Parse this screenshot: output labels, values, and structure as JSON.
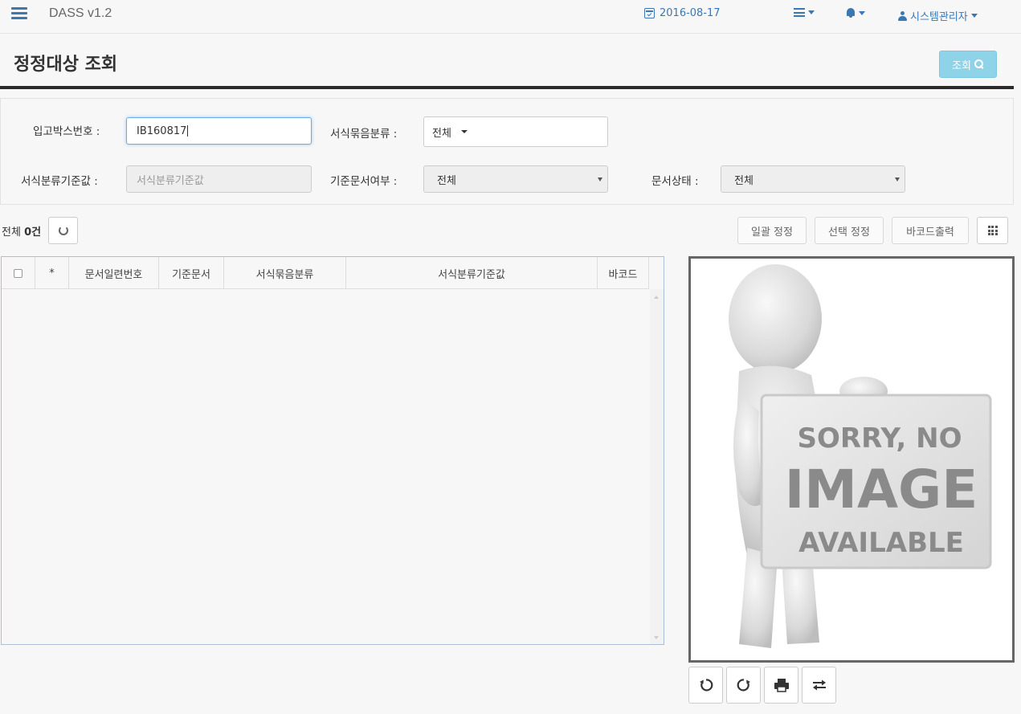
{
  "app": {
    "title": "DASS v1.2",
    "date": "2016-08-17",
    "user": "시스템관리자"
  },
  "page": {
    "title": "정정대상 조회",
    "search_label": "조회"
  },
  "form": {
    "box_no_label": "입고박스번호 :",
    "box_no_value": "IB160817",
    "group_label": "서식묶음분류 :",
    "group_value": "전체",
    "criteria_label": "서식분류기준값 :",
    "criteria_placeholder": "서식분류기준값",
    "std_doc_label": "기준문서여부 :",
    "std_doc_value": "전체",
    "doc_status_label": "문서상태 :",
    "doc_status_value": "전체"
  },
  "toolbar": {
    "count_prefix": "전체",
    "count_value": "0건",
    "bulk_correct": "일괄 정정",
    "select_correct": "선택 정정",
    "barcode_print": "바코드출력"
  },
  "table": {
    "columns": [
      "*",
      "문서일련번호",
      "기준문서",
      "서식묶음분류",
      "서식분류기준값",
      "바코드"
    ],
    "rows": []
  },
  "viewer": {
    "placeholder_line1": "SORRY, NO",
    "placeholder_line2": "IMAGE",
    "placeholder_line3": "AVAILABLE"
  },
  "icons": {
    "menu": "menu-icon",
    "calendar": "calendar-icon",
    "list": "list-icon",
    "bell": "bell-icon",
    "user": "user-icon",
    "search": "search-icon",
    "refresh": "refresh-icon",
    "grid": "grid-icon",
    "rotate_left": "rotate-left-icon",
    "rotate_right": "rotate-right-icon",
    "print": "print-icon",
    "swap": "swap-icon"
  },
  "colors": {
    "accent": "#3a78b5",
    "search_button": "#8fd3e8",
    "title_rule": "#2b2b2b"
  }
}
